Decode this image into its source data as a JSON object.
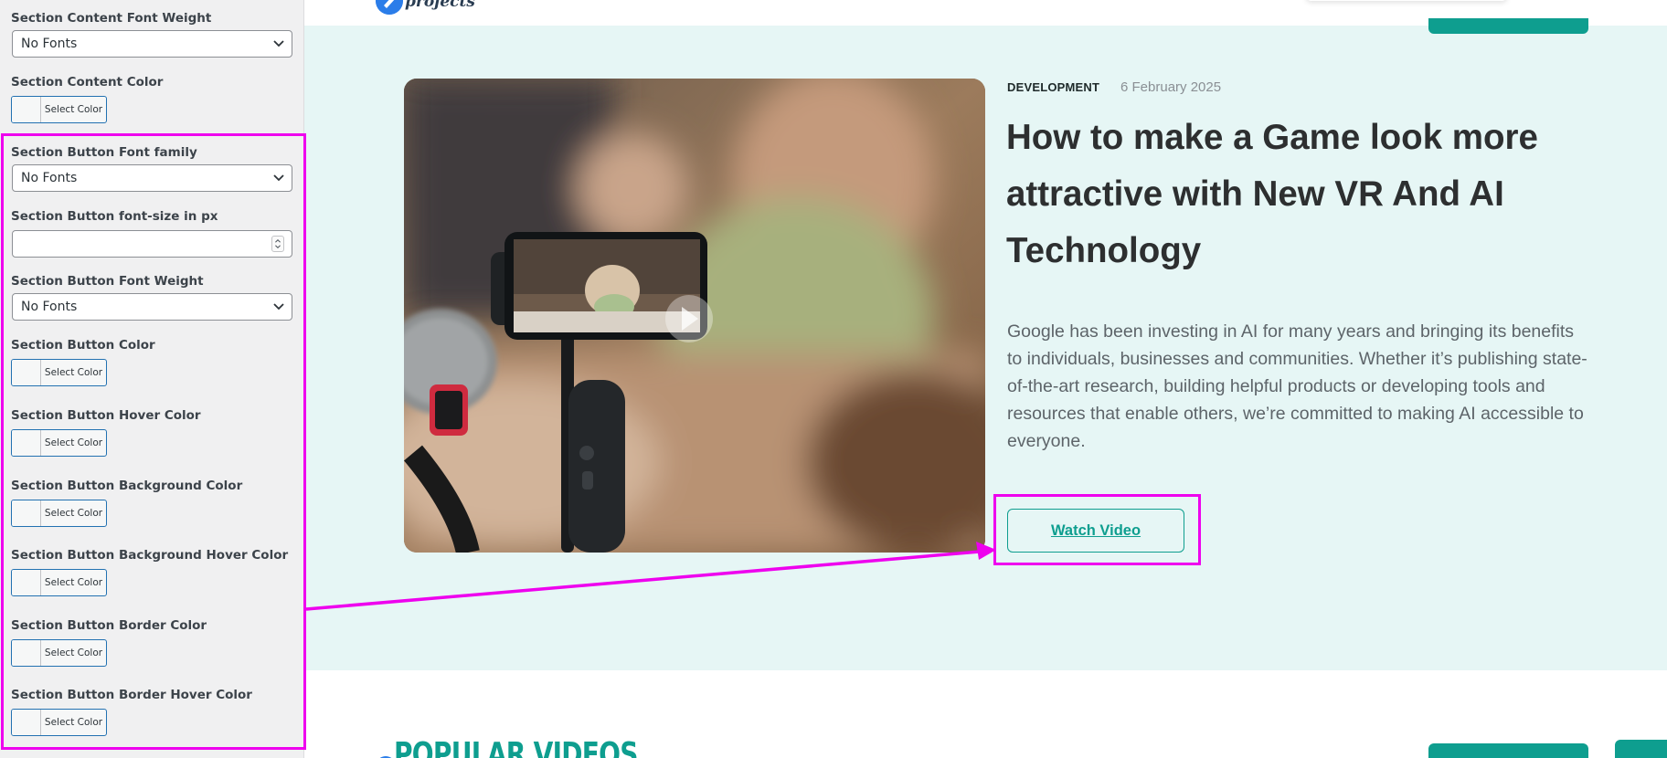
{
  "sidebar": {
    "fields": [
      {
        "label": "Section Content Font Weight",
        "type": "select",
        "value": "No Fonts"
      },
      {
        "label": "Section Content Color",
        "type": "color",
        "button": "Select Color"
      },
      {
        "label": "Section Button Font family",
        "type": "select",
        "value": "No Fonts"
      },
      {
        "label": "Section Button font-size in px",
        "type": "number",
        "value": ""
      },
      {
        "label": "Section Button Font Weight",
        "type": "select",
        "value": "No Fonts"
      },
      {
        "label": "Section Button Color",
        "type": "color",
        "button": "Select Color"
      },
      {
        "label": "Section Button Hover Color",
        "type": "color",
        "button": "Select Color"
      },
      {
        "label": "Section Button Background Color",
        "type": "color",
        "button": "Select Color"
      },
      {
        "label": "Section Button Background Hover Color",
        "type": "color",
        "button": "Select Color"
      },
      {
        "label": "Section Button Border Color",
        "type": "color",
        "button": "Select Color"
      },
      {
        "label": "Section Button Border Hover Color",
        "type": "color",
        "button": "Select Color"
      }
    ]
  },
  "header": {
    "logo_text": "projects"
  },
  "hero": {
    "category": "DEVELOPMENT",
    "date": "6 February 2025",
    "title": "How to make a Game look more attractive with New VR And AI Technology",
    "excerpt": "Google has been investing in AI for many years and bringing its benefits to individuals, businesses and communities. Whether it’s publishing state-of-the-art research, building helpful products or developing tools and resources that enable others, we’re committed to making AI accessible to everyone.",
    "button_label": "Watch Video"
  },
  "popular": {
    "heading": "POPULAR VIDEOS"
  },
  "colors": {
    "accent": "#0e9e8f",
    "hero_background": "#e6f6f5",
    "annotation": "#ee00ee",
    "title_text": "#2d2f30"
  },
  "icons": [
    "chevron-down-icon",
    "number-spinner-icon",
    "play-icon",
    "logo-icon"
  ]
}
